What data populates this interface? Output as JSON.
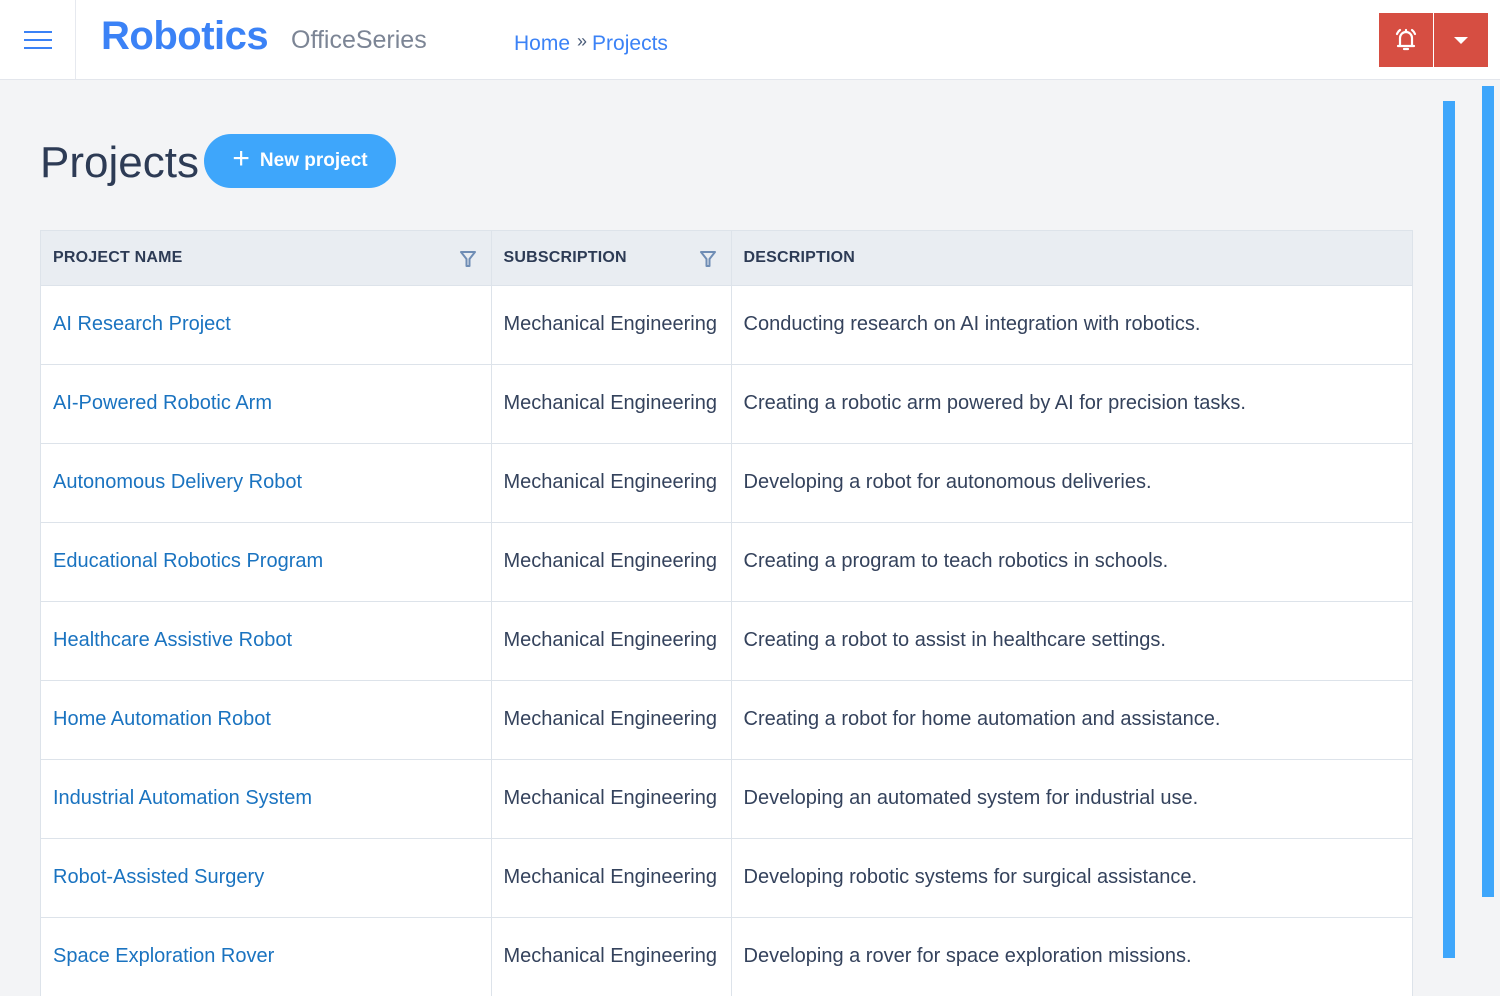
{
  "header": {
    "menu_icon": "hamburger-icon",
    "brand": "Robotics",
    "subbrand": "OfficeSeries",
    "breadcrumb": [
      {
        "label": "Home"
      },
      {
        "label": "Projects"
      }
    ],
    "breadcrumb_separator": "»",
    "alert_icon": "bell-ringing-icon",
    "alert_caret_icon": "caret-down-icon",
    "colors": {
      "brand": "#3b82f6",
      "alert": "#d64e42"
    }
  },
  "page": {
    "title": "Projects",
    "new_button": {
      "icon": "plus-icon",
      "label": "New project",
      "color": "#3ea6fb"
    }
  },
  "table": {
    "columns": [
      {
        "label": "PROJECT NAME",
        "filter": true
      },
      {
        "label": "SUBSCRIPTION",
        "filter": true
      },
      {
        "label": "DESCRIPTION",
        "filter": false
      }
    ],
    "rows": [
      {
        "name": "AI Research Project",
        "subscription": "Mechanical Engineering",
        "description": "Conducting research on AI integration with robotics."
      },
      {
        "name": "AI-Powered Robotic Arm",
        "subscription": "Mechanical Engineering",
        "description": "Creating a robotic arm powered by AI for precision tasks."
      },
      {
        "name": "Autonomous Delivery Robot",
        "subscription": "Mechanical Engineering",
        "description": "Developing a robot for autonomous deliveries."
      },
      {
        "name": "Educational Robotics Program",
        "subscription": "Mechanical Engineering",
        "description": "Creating a program to teach robotics in schools."
      },
      {
        "name": "Healthcare Assistive Robot",
        "subscription": "Mechanical Engineering",
        "description": "Creating a robot to assist in healthcare settings."
      },
      {
        "name": "Home Automation Robot",
        "subscription": "Mechanical Engineering",
        "description": "Creating a robot for home automation and assistance."
      },
      {
        "name": "Industrial Automation System",
        "subscription": "Mechanical Engineering",
        "description": "Developing an automated system for industrial use."
      },
      {
        "name": "Robot-Assisted Surgery",
        "subscription": "Mechanical Engineering",
        "description": "Developing robotic systems for surgical assistance."
      },
      {
        "name": "Space Exploration Rover",
        "subscription": "Mechanical Engineering",
        "description": "Developing a rover for space exploration missions."
      }
    ]
  }
}
